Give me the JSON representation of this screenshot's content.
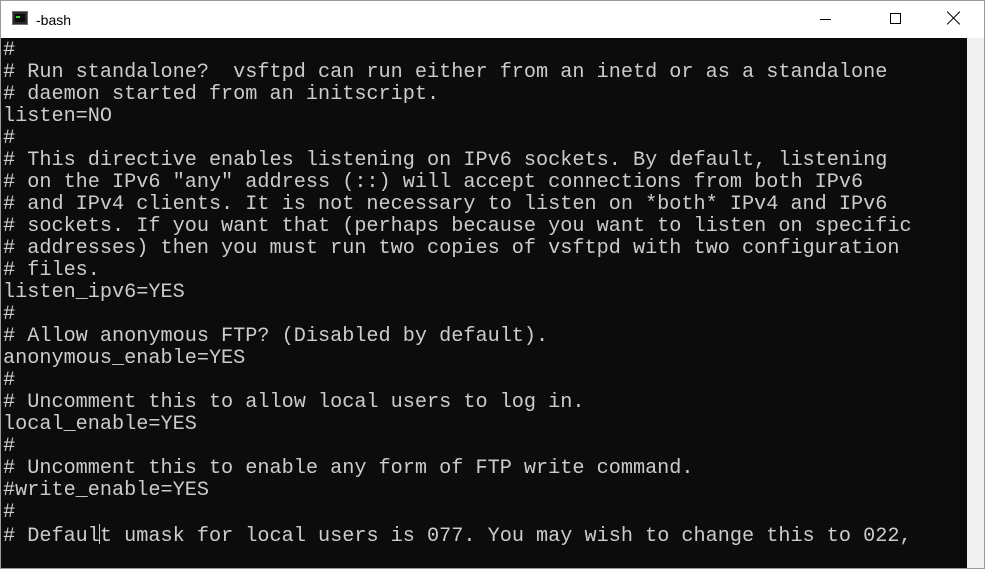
{
  "window": {
    "title": "-bash",
    "app_icon": "terminal-icon",
    "buttons": [
      "minimize-icon",
      "maximize-icon",
      "close-icon"
    ]
  },
  "colors": {
    "terminal_bg": "#0c0c0c",
    "terminal_fg": "#cccccc",
    "titlebar_bg": "#ffffff"
  },
  "terminal": {
    "lines": [
      "#",
      "# Run standalone?  vsftpd can run either from an inetd or as a standalone",
      "# daemon started from an initscript.",
      "listen=NO",
      "#",
      "# This directive enables listening on IPv6 sockets. By default, listening",
      "# on the IPv6 \"any\" address (::) will accept connections from both IPv6",
      "# and IPv4 clients. It is not necessary to listen on *both* IPv4 and IPv6",
      "# sockets. If you want that (perhaps because you want to listen on specific",
      "# addresses) then you must run two copies of vsftpd with two configuration",
      "# files.",
      "listen_ipv6=YES",
      "#",
      "# Allow anonymous FTP? (Disabled by default).",
      "anonymous_enable=YES",
      "#",
      "# Uncomment this to allow local users to log in.",
      "local_enable=YES",
      "#",
      "# Uncomment this to enable any form of FTP write command.",
      "#write_enable=YES",
      "#",
      "# Default umask for local users is 077. You may wish to change this to 022,"
    ],
    "last_line_before_cursor": "# Defaul",
    "last_line_after_cursor": "t umask for local users is 077. You may wish to change this to 022,"
  }
}
